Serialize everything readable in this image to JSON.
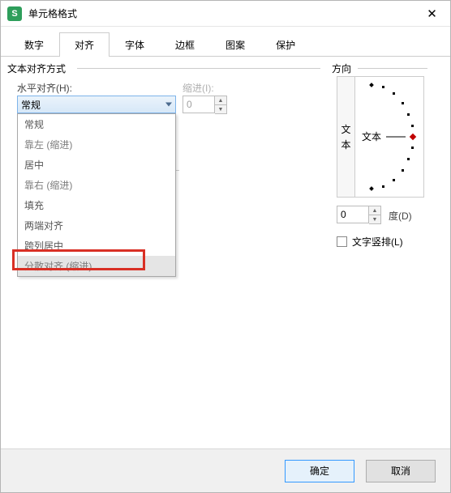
{
  "window": {
    "title": "单元格格式"
  },
  "tabs": {
    "items": [
      "数字",
      "对齐",
      "字体",
      "边框",
      "图案",
      "保护"
    ],
    "active_index": 1
  },
  "align": {
    "group_label": "文本对齐方式",
    "horizontal_label": "水平对齐(H):",
    "horizontal_value": "常规",
    "horizontal_options": [
      "常规",
      "靠左 (缩进)",
      "居中",
      "靠右 (缩进)",
      "填充",
      "两端对齐",
      "跨列居中",
      "分散对齐 (缩进)"
    ],
    "indent_label": "缩进(I):",
    "indent_value": "0"
  },
  "orientation": {
    "group_label": "方向",
    "vertical_text": "文本",
    "center_text": "文本",
    "degree_value": "0",
    "degree_label": "度(D)",
    "vertical_checkbox_label": "文字竖排(L)"
  },
  "footer": {
    "ok": "确定",
    "cancel": "取消"
  }
}
